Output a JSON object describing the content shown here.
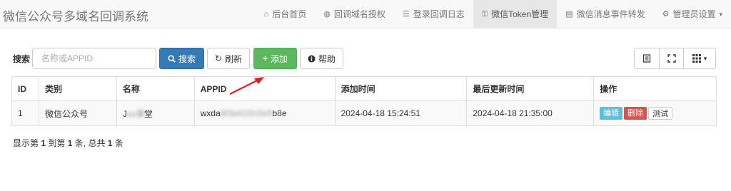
{
  "brand": "微信公众号多域名回调系统",
  "nav": [
    {
      "label": "后台首页",
      "icon": "home-icon",
      "glyph": "⌂",
      "active": false
    },
    {
      "label": "回调域名授权",
      "icon": "globe-icon",
      "glyph": "◍",
      "active": false
    },
    {
      "label": "登录回调日志",
      "icon": "list-icon",
      "glyph": "☰",
      "active": false
    },
    {
      "label": "微信Token管理",
      "icon": "key-icon",
      "glyph": "⚿",
      "active": true
    },
    {
      "label": "微信消息事件转发",
      "icon": "list-alt-icon",
      "glyph": "▤",
      "active": false
    },
    {
      "label": "管理员设置",
      "icon": "cog-icon",
      "glyph": "⚙",
      "active": false
    }
  ],
  "toolbar": {
    "search_label": "搜索",
    "search_placeholder": "名称或APPID",
    "search_button": "搜索",
    "refresh_button": "刷新",
    "add_button": "添加",
    "help_button": "帮助"
  },
  "table": {
    "headers": [
      "ID",
      "类别",
      "名称",
      "APPID",
      "添加时间",
      "最后更新时间",
      "操作"
    ],
    "rows": [
      {
        "id": "1",
        "category": "微信公众号",
        "name_prefix": "J",
        "name_blur": "xx课",
        "name_suffix": "堂",
        "appid_prefix": "wxda",
        "appid_blur": "9f3a41f2c0e5",
        "appid_suffix": "b8e",
        "added": "2024-04-18 15:24:51",
        "updated": "2024-04-18 21:35:00",
        "actions": {
          "edit": "编辑",
          "delete": "删除",
          "test": "测试"
        }
      }
    ]
  },
  "footer": {
    "pre": "显示第",
    "from": "1",
    "mid1": "到第",
    "to": "1",
    "mid2": "条, 总共",
    "total": "1",
    "post": "条"
  },
  "colors": {
    "primary": "#337ab7",
    "success": "#5cb85c",
    "info": "#5bc0de",
    "danger": "#d9534f",
    "arrow": "#e02020"
  }
}
